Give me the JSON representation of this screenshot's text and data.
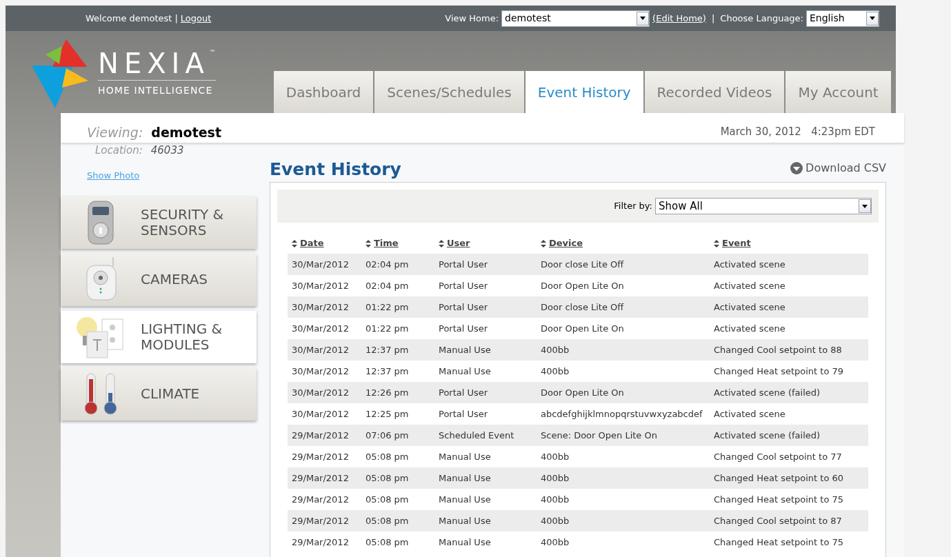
{
  "top_bar": {
    "welcome": "Welcome demotest",
    "separator": "|",
    "logout": "Logout",
    "view_home_label": "View Home:",
    "home_select": "demotest",
    "edit_home": "(Edit Home)",
    "separator_2": "|",
    "language_label": "Choose Language:",
    "language_select": "English"
  },
  "logo": {
    "name": "NEXIA",
    "trademark": "™",
    "tagline": "HOME INTELLIGENCE"
  },
  "tabs": [
    {
      "label": "Dashboard",
      "selected": false
    },
    {
      "label": "Scenes/Schedules",
      "selected": false
    },
    {
      "label": "Event History",
      "selected": true
    },
    {
      "label": "Recorded Videos",
      "selected": false
    },
    {
      "label": "My Account",
      "selected": false
    }
  ],
  "info": {
    "viewing_label": "Viewing:",
    "viewing_value": "demotest",
    "location_label": "Location:",
    "location_value": "46033",
    "show_photo": "Show Photo",
    "date": "March 30, 2012",
    "time": "4:23pm EDT"
  },
  "sidebar": [
    {
      "label": "SECURITY & SENSORS",
      "kind": "security",
      "selected": false
    },
    {
      "label": "CAMERAS",
      "kind": "camera",
      "selected": false
    },
    {
      "label": "LIGHTING & MODULES",
      "kind": "lighting",
      "selected": true
    },
    {
      "label": "CLIMATE",
      "kind": "climate",
      "selected": false
    }
  ],
  "page_title": "Event History",
  "download": "Download CSV",
  "filter": {
    "label": "Filter by:",
    "value": "Show All"
  },
  "table": {
    "columns": [
      "Date",
      "Time",
      "User",
      "Device",
      "Event"
    ],
    "rows": [
      [
        "30/Mar/2012",
        "02:04 pm",
        "Portal User",
        "Door close Lite Off",
        "Activated scene"
      ],
      [
        "30/Mar/2012",
        "02:04 pm",
        "Portal User",
        "Door Open Lite On",
        "Activated scene"
      ],
      [
        "30/Mar/2012",
        "01:22 pm",
        "Portal User",
        "Door close Lite Off",
        "Activated scene"
      ],
      [
        "30/Mar/2012",
        "01:22 pm",
        "Portal User",
        "Door Open Lite On",
        "Activated scene"
      ],
      [
        "30/Mar/2012",
        "12:37 pm",
        "Manual Use",
        "400bb",
        "Changed Cool setpoint to 88"
      ],
      [
        "30/Mar/2012",
        "12:37 pm",
        "Manual Use",
        "400bb",
        "Changed Heat setpoint to 79"
      ],
      [
        "30/Mar/2012",
        "12:26 pm",
        "Portal User",
        "Door Open Lite On",
        "Activated scene (failed)"
      ],
      [
        "30/Mar/2012",
        "12:25 pm",
        "Portal User",
        "abcdefghijklmnopqrstuvwxyzabcdef",
        "Activated scene"
      ],
      [
        "29/Mar/2012",
        "07:06 pm",
        "Scheduled Event",
        "Scene: Door Open Lite On",
        "Activated scene (failed)"
      ],
      [
        "29/Mar/2012",
        "05:08 pm",
        "Manual Use",
        "400bb",
        "Changed Cool setpoint to 77"
      ],
      [
        "29/Mar/2012",
        "05:08 pm",
        "Manual Use",
        "400bb",
        "Changed Heat setpoint to 60"
      ],
      [
        "29/Mar/2012",
        "05:08 pm",
        "Manual Use",
        "400bb",
        "Changed Heat setpoint to 75"
      ],
      [
        "29/Mar/2012",
        "05:08 pm",
        "Manual Use",
        "400bb",
        "Changed Cool setpoint to 87"
      ],
      [
        "29/Mar/2012",
        "05:08 pm",
        "Manual Use",
        "400bb",
        "Changed Heat setpoint to 75"
      ]
    ]
  }
}
